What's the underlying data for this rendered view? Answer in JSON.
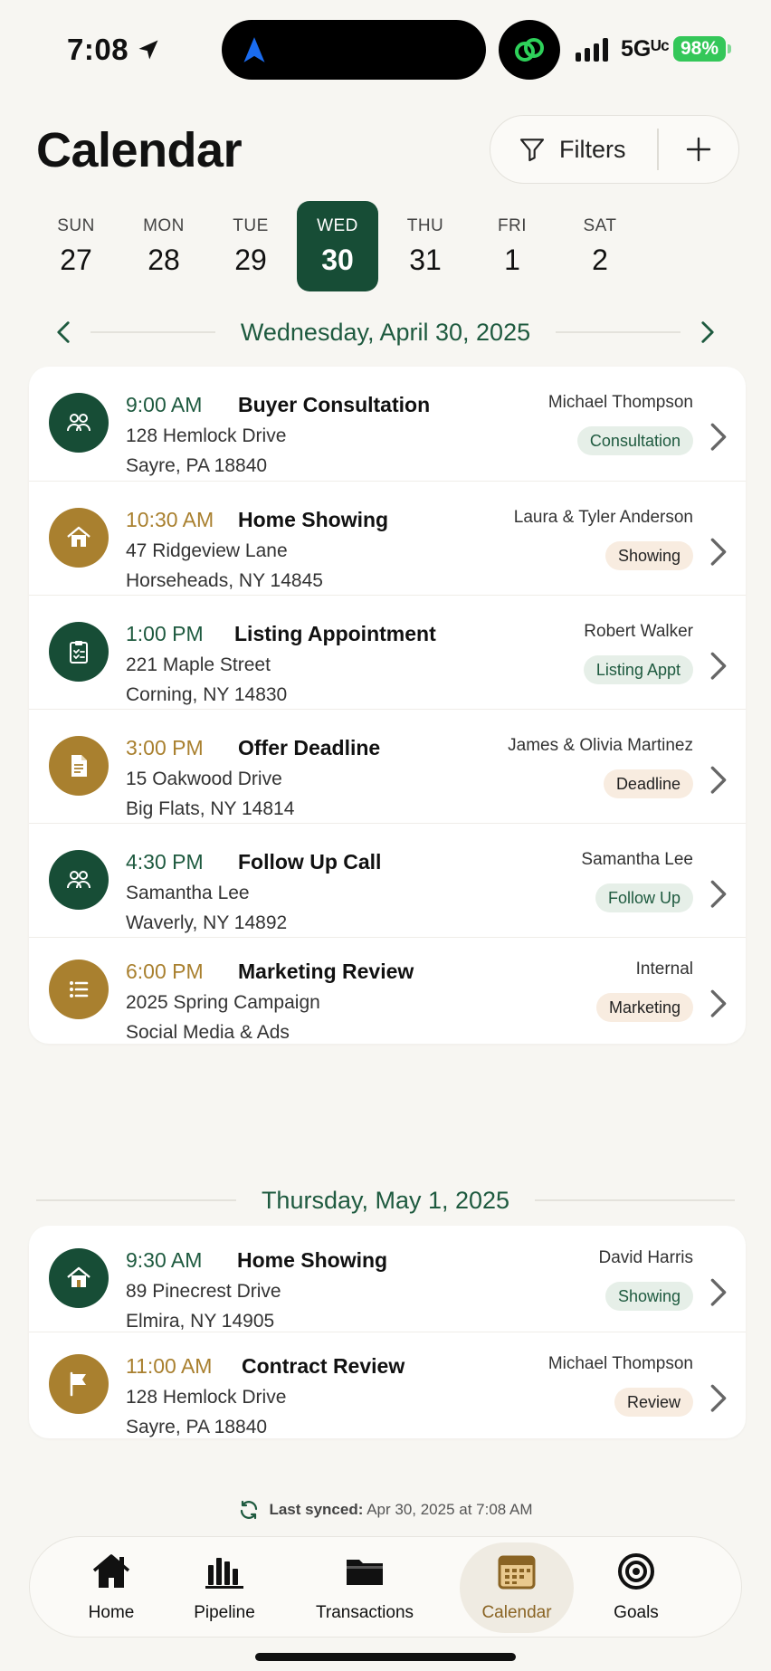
{
  "status_bar": {
    "time": "7:08",
    "network": "5Gᵁᶜ",
    "battery": "98%"
  },
  "header": {
    "title": "Calendar",
    "filters_label": "Filters"
  },
  "week": [
    {
      "name": "SUN",
      "date": "27",
      "selected": false
    },
    {
      "name": "MON",
      "date": "28",
      "selected": false
    },
    {
      "name": "TUE",
      "date": "29",
      "selected": false
    },
    {
      "name": "WED",
      "date": "30",
      "selected": true
    },
    {
      "name": "THU",
      "date": "31",
      "selected": false
    },
    {
      "name": "FRI",
      "date": "1",
      "selected": false
    },
    {
      "name": "SAT",
      "date": "2",
      "selected": false
    }
  ],
  "days": [
    {
      "label": "Wednesday, April 30, 2025",
      "events": [
        {
          "time": "9:00 AM",
          "title": "Buyer Consultation",
          "address1": "128 Hemlock Drive",
          "address2": "Sayre, PA 18840",
          "client": "Michael Thompson",
          "badge": "Consultation",
          "tone": "green",
          "icon": "people-icon"
        },
        {
          "time": "10:30 AM",
          "title": "Home Showing",
          "address1": "47 Ridgeview Lane",
          "address2": "Horseheads, NY 14845",
          "client": "Laura & Tyler Anderson",
          "badge": "Showing",
          "tone": "gold",
          "icon": "house-icon"
        },
        {
          "time": "1:00 PM",
          "title": "Listing Appointment",
          "address1": "221 Maple Street",
          "address2": "Corning, NY 14830",
          "client": "Robert Walker",
          "badge": "Listing Appt",
          "tone": "green",
          "icon": "clipboard-icon"
        },
        {
          "time": "3:00 PM",
          "title": "Offer Deadline",
          "address1": "15 Oakwood Drive",
          "address2": "Big Flats, NY 14814",
          "client": "James & Olivia Martinez",
          "badge": "Deadline",
          "tone": "gold",
          "icon": "document-icon"
        },
        {
          "time": "4:30 PM",
          "title": "Follow Up Call",
          "address1": "Samantha Lee",
          "address2": "Waverly, NY 14892",
          "client": "Samantha Lee",
          "badge": "Follow Up",
          "tone": "green",
          "icon": "people-icon"
        },
        {
          "time": "6:00 PM",
          "title": "Marketing Review",
          "address1": "2025 Spring Campaign",
          "address2": "Social Media & Ads",
          "client": "Internal",
          "badge": "Marketing",
          "tone": "gold",
          "icon": "list-icon"
        }
      ]
    },
    {
      "label": "Thursday, May 1, 2025",
      "events": [
        {
          "time": "9:30 AM",
          "title": "Home Showing",
          "address1": "89 Pinecrest Drive",
          "address2": "Elmira, NY 14905",
          "client": "David Harris",
          "badge": "Showing",
          "tone": "green",
          "icon": "house-icon"
        },
        {
          "time": "11:00 AM",
          "title": "Contract Review",
          "address1": "128 Hemlock Drive",
          "address2": "Sayre, PA 18840",
          "client": "Michael Thompson",
          "badge": "Review",
          "tone": "gold",
          "icon": "flag-icon"
        }
      ]
    }
  ],
  "sync": {
    "label": "Last synced:",
    "value": "Apr 30, 2025 at 7:08 AM"
  },
  "tabs": [
    {
      "label": "Home",
      "icon": "home-icon",
      "active": false
    },
    {
      "label": "Pipeline",
      "icon": "pipeline-icon",
      "active": false
    },
    {
      "label": "Transactions",
      "icon": "folder-icon",
      "active": false
    },
    {
      "label": "Calendar",
      "icon": "calendar-icon",
      "active": true
    },
    {
      "label": "Goals",
      "icon": "target-icon",
      "active": false
    }
  ],
  "colors": {
    "green": "#174d36",
    "gold": "#a9802f",
    "background": "#f7f6f2"
  }
}
